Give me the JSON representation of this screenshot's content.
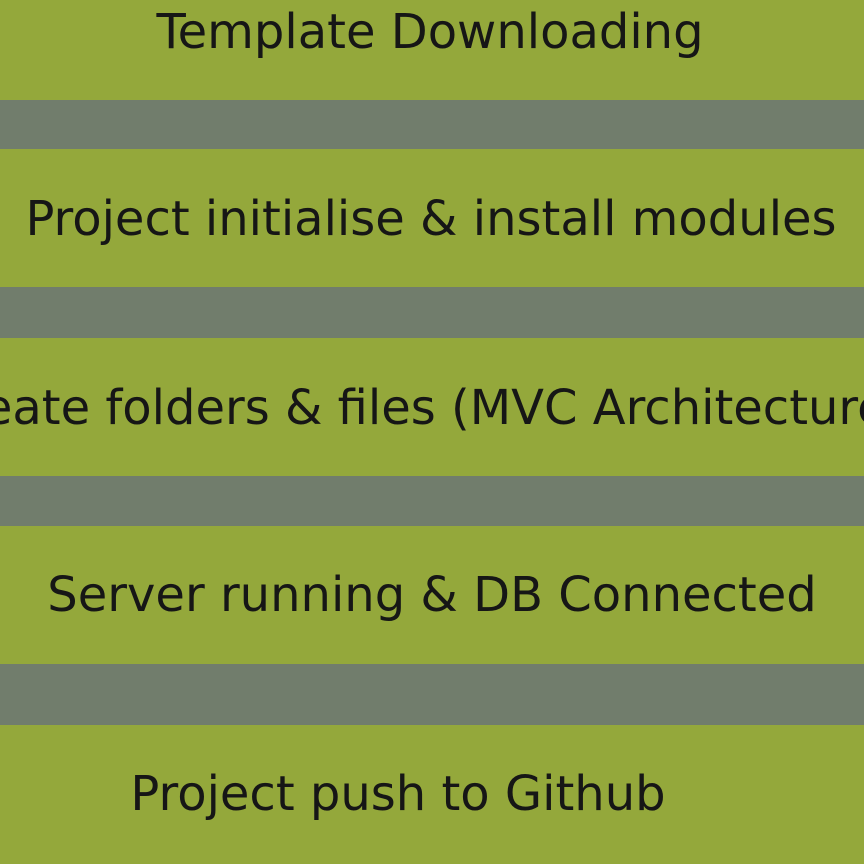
{
  "steps": [
    {
      "label": "Template Downloading"
    },
    {
      "label": "Project initialise & install modules"
    },
    {
      "label": "Create folders & files (MVC Architecture)"
    },
    {
      "label": "Server running & DB Connected"
    },
    {
      "label": "Project push to Github"
    }
  ],
  "colors": {
    "step_fill": "#94A83B",
    "gap_fill": "#717D6C",
    "text": "#161616"
  }
}
